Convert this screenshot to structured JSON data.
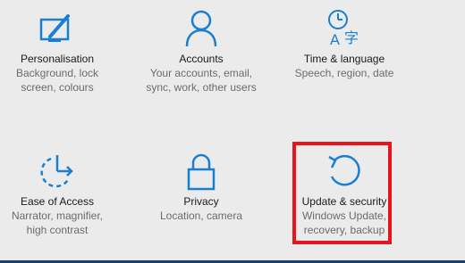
{
  "tiles": [
    {
      "title": "Personalisation",
      "desc1": "Background, lock",
      "desc2": "screen, colours",
      "icon": "personalisation-icon"
    },
    {
      "title": "Accounts",
      "desc1": "Your accounts, email,",
      "desc2": "sync, work, other users",
      "icon": "accounts-icon"
    },
    {
      "title": "Time & language",
      "desc1": "Speech, region, date",
      "desc2": "",
      "icon": "time-language-icon"
    },
    {
      "title": "Ease of Access",
      "desc1": "Narrator, magnifier,",
      "desc2": "high contrast",
      "icon": "ease-of-access-icon"
    },
    {
      "title": "Privacy",
      "desc1": "Location, camera",
      "desc2": "",
      "icon": "privacy-icon"
    },
    {
      "title": "Update & security",
      "desc1": "Windows Update,",
      "desc2": "recovery, backup",
      "icon": "update-security-icon"
    }
  ],
  "colors": {
    "accent": "#1a7fd0",
    "highlight": "#e8141c",
    "background": "#ebebeb"
  }
}
